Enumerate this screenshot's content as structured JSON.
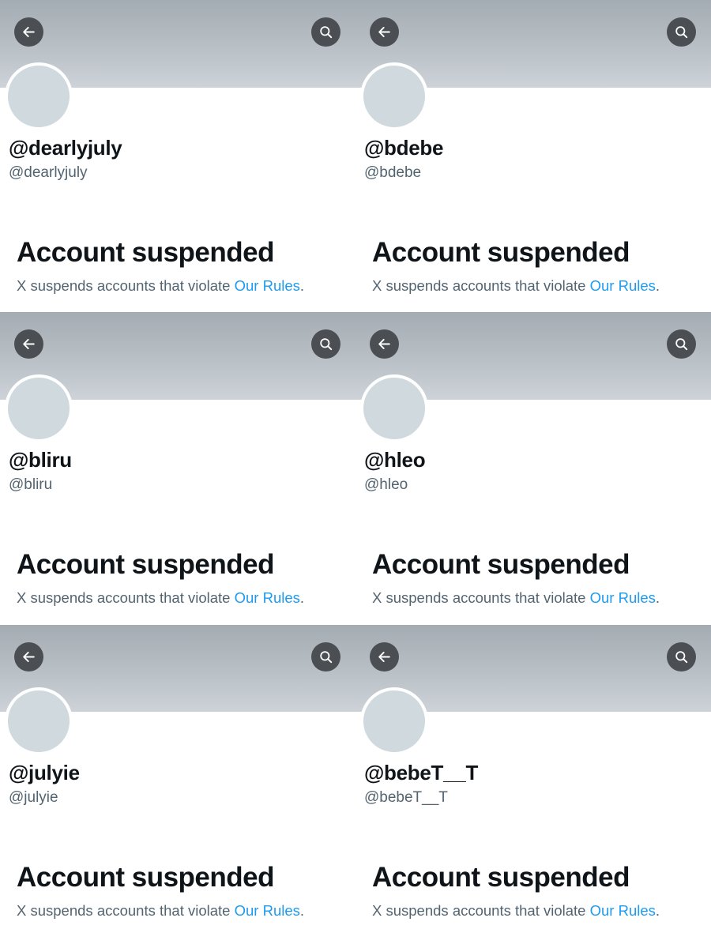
{
  "colors": {
    "banner_gray": "#b7bec4",
    "avatar_gray": "#cfd9de",
    "icon_button_bg": "#4b4f54",
    "title_text": "#0f1419",
    "secondary_text": "#536471",
    "link_blue": "#1d9bf0"
  },
  "icons": {
    "back": "arrow-left-icon",
    "search": "search-icon"
  },
  "profiles": [
    {
      "display_name": "@dearlyjuly",
      "handle": "@dearlyjuly",
      "status_title": "Account suspended",
      "status_message": "X suspends accounts that violate ",
      "rules_link": "Our Rules",
      "trailing_period": "."
    },
    {
      "display_name": "@bdebe",
      "handle": "@bdebe",
      "status_title": "Account suspended",
      "status_message": "X suspends accounts that violate ",
      "rules_link": "Our Rules",
      "trailing_period": "."
    },
    {
      "display_name": "@bliru",
      "handle": "@bliru",
      "status_title": "Account suspended",
      "status_message": "X suspends accounts that violate ",
      "rules_link": "Our Rules",
      "trailing_period": "."
    },
    {
      "display_name": "@hleo",
      "handle": "@hleo",
      "status_title": "Account suspended",
      "status_message": "X suspends accounts that violate ",
      "rules_link": "Our Rules",
      "trailing_period": "."
    },
    {
      "display_name": "@julyie",
      "handle": "@julyie",
      "status_title": "Account suspended",
      "status_message": "X suspends accounts that violate ",
      "rules_link": "Our Rules",
      "trailing_period": "."
    },
    {
      "display_name": "@bebeT__T",
      "handle": "@bebeT__T",
      "status_title": "Account suspended",
      "status_message": "X suspends accounts that violate ",
      "rules_link": "Our Rules",
      "trailing_period": "."
    }
  ]
}
